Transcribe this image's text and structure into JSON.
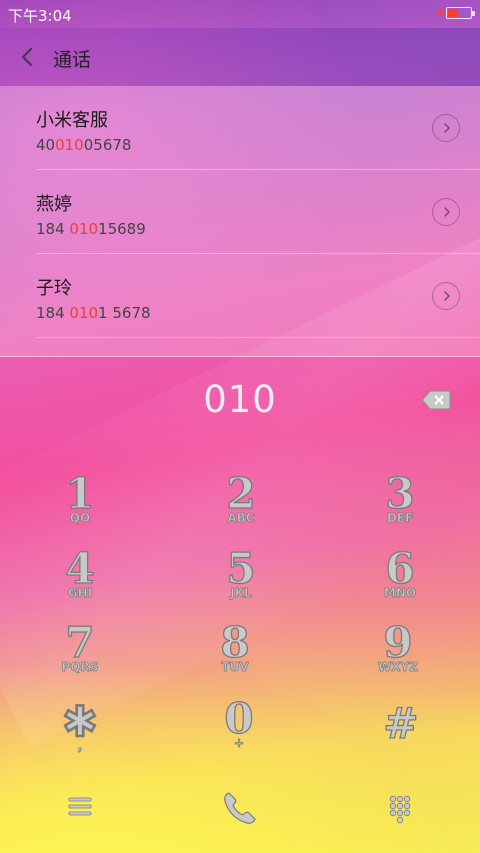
{
  "status_bar": {
    "time": "下午3:04"
  },
  "header": {
    "title": "通话"
  },
  "results": [
    {
      "name": "小米客服",
      "number_parts": [
        "40",
        "010",
        "05678"
      ]
    },
    {
      "name": "燕婷",
      "number_parts": [
        "184 ",
        "010",
        "15689"
      ]
    },
    {
      "name": "子玲",
      "number_parts": [
        "184 ",
        "010",
        "1 5678"
      ]
    }
  ],
  "dialed_digits": "010",
  "keypad": [
    {
      "digit": "1",
      "letters": "QO"
    },
    {
      "digit": "2",
      "letters": "ABC"
    },
    {
      "digit": "3",
      "letters": "DEF"
    },
    {
      "digit": "4",
      "letters": "GHI"
    },
    {
      "digit": "5",
      "letters": "JKL"
    },
    {
      "digit": "6",
      "letters": "MNO"
    },
    {
      "digit": "7",
      "letters": "PQRS"
    },
    {
      "digit": "8",
      "letters": "TUV"
    },
    {
      "digit": "9",
      "letters": "WXYZ"
    },
    {
      "digit": "✱",
      "letters": ","
    },
    {
      "digit": "0",
      "letters": "+"
    },
    {
      "digit": "#",
      "letters": ""
    }
  ],
  "colors": {
    "highlight": "#e9413a",
    "key_fill": "#c9c9c9",
    "key_stroke": "#7a7a7a"
  }
}
